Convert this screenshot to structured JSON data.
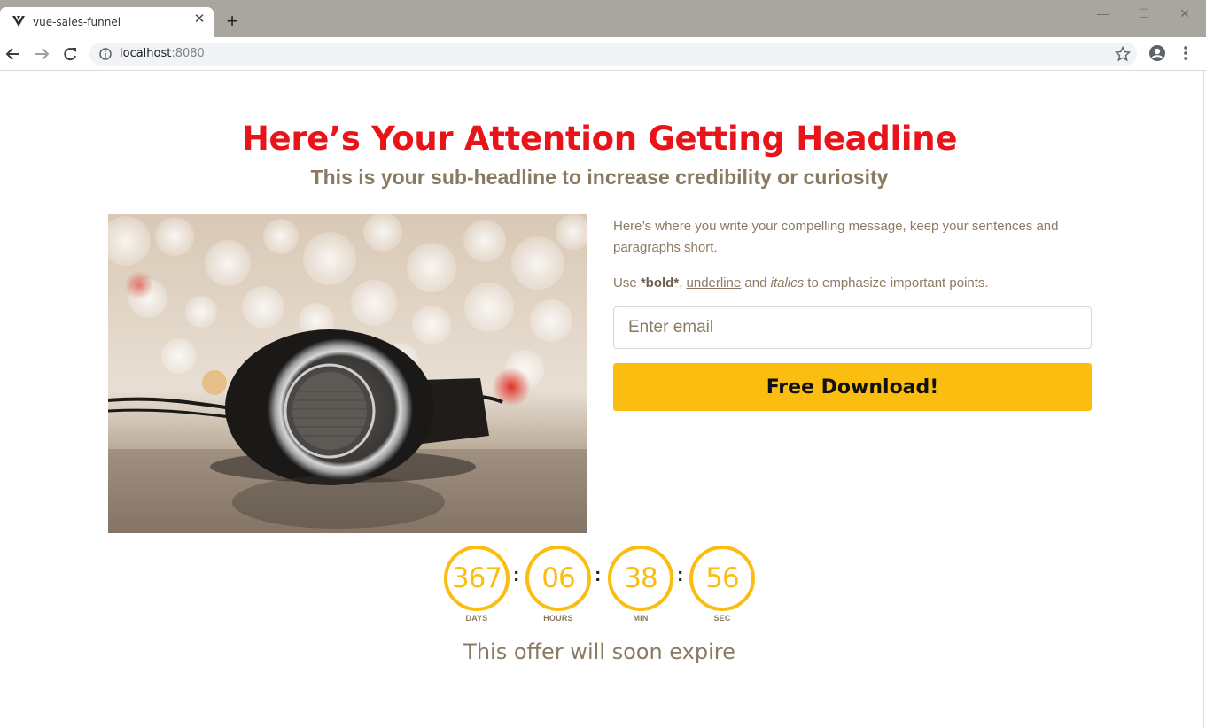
{
  "browser": {
    "tab_title": "vue-sales-funnel",
    "url_host": "localhost",
    "url_port": ":8080"
  },
  "page": {
    "headline": "Here’s Your Attention Getting Headline",
    "subheadline": "This is your sub-headline to increase credibility or curiosity",
    "message_p1": "Here’s where you write your compelling message, keep your sentences and paragraphs short.",
    "message_p2_prefix": "Use ",
    "message_p2_bold": "*bold*",
    "message_p2_comma": ", ",
    "message_p2_underline": "underline",
    "message_p2_and": " and ",
    "message_p2_italics": "italics",
    "message_p2_suffix": " to emphasize important points.",
    "email_placeholder": "Enter email",
    "button_label": "Free Download!",
    "countdown": {
      "days": "367",
      "hours": "06",
      "minutes": "38",
      "seconds": "56",
      "days_label": "DAYS",
      "hours_label": "HOURS",
      "minutes_label": "MIN",
      "seconds_label": "SEC",
      "separator": ":"
    },
    "expire_text": "This offer will soon expire"
  },
  "colors": {
    "headline": "#e8141a",
    "accent": "#fbbd10",
    "body_text": "#8b7a62"
  }
}
